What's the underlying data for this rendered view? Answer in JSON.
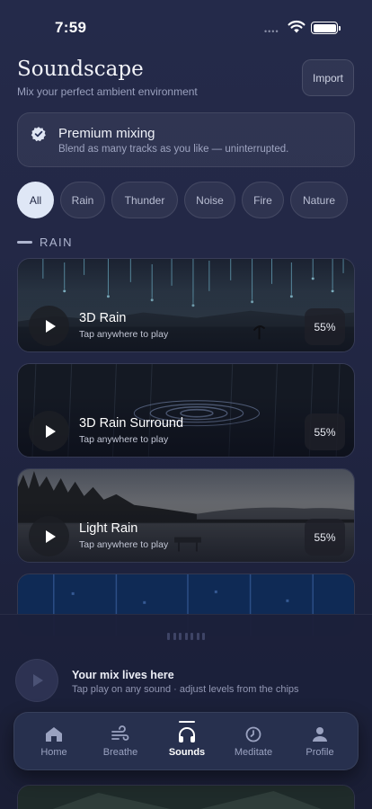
{
  "status": {
    "time": "7:59"
  },
  "header": {
    "title": "Soundscape",
    "subtitle": "Mix your perfect ambient environment",
    "import_label": "Import"
  },
  "premium": {
    "icon": "verified-badge-icon",
    "title": "Premium mixing",
    "description": "Blend as many tracks as you like — uninterrupted."
  },
  "filters": {
    "selected": "All",
    "chips": [
      "All",
      "Rain",
      "Thunder",
      "Noise",
      "Fire",
      "Nature"
    ]
  },
  "section": {
    "label": "RAIN"
  },
  "sounds": [
    {
      "name": "3D Rain",
      "hint": "Tap anywhere to play",
      "level": "55%"
    },
    {
      "name": "3D Rain Surround",
      "hint": "Tap anywhere to play",
      "level": "55%"
    },
    {
      "name": "Light Rain",
      "hint": "Tap anywhere to play",
      "level": "55%"
    }
  ],
  "mini_player": {
    "title": "Your mix lives here",
    "subtitle": "Tap play on any sound · adjust levels from the chips"
  },
  "tabs": [
    {
      "label": "Home",
      "icon": "home-icon"
    },
    {
      "label": "Breathe",
      "icon": "wind-icon"
    },
    {
      "label": "Sounds",
      "icon": "headphones-icon",
      "active": true
    },
    {
      "label": "Meditate",
      "icon": "clock-icon"
    },
    {
      "label": "Profile",
      "icon": "person-icon"
    }
  ],
  "colors": {
    "background": "#232846",
    "accent_chip": "#dfe7f6",
    "tab_bar": "#27304e"
  }
}
